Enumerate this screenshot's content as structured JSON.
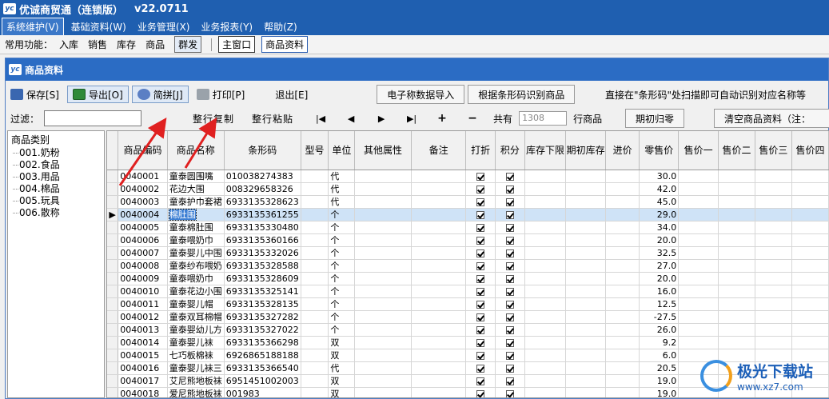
{
  "app": {
    "title": "优诚商贸通（连锁版）",
    "version": "v22.0711"
  },
  "menu": [
    {
      "label": "系统维护(V)",
      "active": true
    },
    {
      "label": "基础资料(W)",
      "active": false
    },
    {
      "label": "业务管理(X)",
      "active": false
    },
    {
      "label": "业务报表(Y)",
      "active": false
    },
    {
      "label": "帮助(Z)",
      "active": false
    }
  ],
  "quick": {
    "label": "常用功能：",
    "items": [
      "入库",
      "销售",
      "库存",
      "商品"
    ],
    "button": "群发",
    "tabs": [
      "主窗口",
      "商品资料"
    ]
  },
  "window": {
    "title": "商品资料"
  },
  "toolbar": {
    "save": "保存[S]",
    "export": "导出[O]",
    "pinyin": "简拼[J]",
    "print": "打印[P]",
    "exit": "退出[E]",
    "scale_import": "电子称数据导入",
    "barcode_identify": "根据条形码识别商品",
    "hint": "直接在\"条形码\"处扫描即可自动识别对应名称等"
  },
  "filter": {
    "label": "过滤：",
    "value": "",
    "copy_row": "整行复制",
    "paste_row": "整行粘贴",
    "nav_first": "|◀",
    "nav_prev": "◀",
    "nav_next": "▶",
    "nav_last": "▶|",
    "add": "+",
    "remove": "−",
    "total_prefix": "共有",
    "total_count": "1308",
    "total_suffix": "行商品",
    "reset_initial": "期初归零",
    "clear_all": "清空商品资料（注："
  },
  "tree": {
    "root": "商品类别",
    "nodes": [
      "001.奶粉",
      "002.食品",
      "003.用品",
      "004.棉品",
      "005.玩具",
      "006.散称"
    ]
  },
  "grid": {
    "columns": [
      "商品编码",
      "商品名称",
      "条形码",
      "型号",
      "单位",
      "其他属性",
      "备注",
      "打折",
      "积分",
      "库存下限",
      "期初库存",
      "进价",
      "零售价",
      "售价一",
      "售价二",
      "售价三",
      "售价四"
    ],
    "current_row_index": 3,
    "rows": [
      {
        "code": "0040001",
        "name": "童泰圆围嘴",
        "barcode": "010038274383",
        "model": "",
        "unit": "代",
        "discount": true,
        "points": true,
        "retail": "30.0"
      },
      {
        "code": "0040002",
        "name": "花边大围",
        "barcode": "008329658326",
        "model": "",
        "unit": "代",
        "discount": true,
        "points": true,
        "retail": "42.0"
      },
      {
        "code": "0040003",
        "name": "童泰护巾套裙",
        "barcode": "6933135328623",
        "model": "",
        "unit": "代",
        "discount": true,
        "points": true,
        "retail": "45.0"
      },
      {
        "code": "0040004",
        "name": "棉肚围",
        "barcode": "6933135361255",
        "model": "",
        "unit": "个",
        "discount": true,
        "points": true,
        "retail": "29.0"
      },
      {
        "code": "0040005",
        "name": "童泰棉肚围",
        "barcode": "6933135330480",
        "model": "",
        "unit": "个",
        "discount": true,
        "points": true,
        "retail": "34.0"
      },
      {
        "code": "0040006",
        "name": "童泰喂奶巾",
        "barcode": "6933135360166",
        "model": "",
        "unit": "个",
        "discount": true,
        "points": true,
        "retail": "20.0"
      },
      {
        "code": "0040007",
        "name": "童泰婴儿中围",
        "barcode": "6933135332026",
        "model": "",
        "unit": "个",
        "discount": true,
        "points": true,
        "retail": "32.5"
      },
      {
        "code": "0040008",
        "name": "童泰纱布喂奶",
        "barcode": "6933135328588",
        "model": "",
        "unit": "个",
        "discount": true,
        "points": true,
        "retail": "27.0"
      },
      {
        "code": "0040009",
        "name": "童泰喂奶巾",
        "barcode": "6933135328609",
        "model": "",
        "unit": "个",
        "discount": true,
        "points": true,
        "retail": "20.0"
      },
      {
        "code": "0040010",
        "name": "童泰花边小围",
        "barcode": "6933135325141",
        "model": "",
        "unit": "个",
        "discount": true,
        "points": true,
        "retail": "16.0"
      },
      {
        "code": "0040011",
        "name": "童泰婴儿帽",
        "barcode": "6933135328135",
        "model": "",
        "unit": "个",
        "discount": true,
        "points": true,
        "retail": "12.5"
      },
      {
        "code": "0040012",
        "name": "童泰双耳棉帽",
        "barcode": "6933135327282",
        "model": "",
        "unit": "个",
        "discount": true,
        "points": true,
        "retail": "-27.5"
      },
      {
        "code": "0040013",
        "name": "童泰婴幼儿方",
        "barcode": "6933135327022",
        "model": "",
        "unit": "个",
        "discount": true,
        "points": true,
        "retail": "26.0"
      },
      {
        "code": "0040014",
        "name": "童泰婴儿袜",
        "barcode": "6933135366298",
        "model": "",
        "unit": "双",
        "discount": true,
        "points": true,
        "retail": "9.2"
      },
      {
        "code": "0040015",
        "name": "七巧板棉袜",
        "barcode": "6926865188188",
        "model": "",
        "unit": "双",
        "discount": true,
        "points": true,
        "retail": "6.0"
      },
      {
        "code": "0040016",
        "name": "童泰婴儿袜三",
        "barcode": "6933135366540",
        "model": "",
        "unit": "代",
        "discount": true,
        "points": true,
        "retail": "20.5"
      },
      {
        "code": "0040017",
        "name": "艾尼熊地板袜",
        "barcode": "6951451002003",
        "model": "",
        "unit": "双",
        "discount": true,
        "points": true,
        "retail": "19.0"
      },
      {
        "code": "0040018",
        "name": "爱尼熊地板袜",
        "barcode": "001983",
        "model": "",
        "unit": "双",
        "discount": true,
        "points": true,
        "retail": "19.0"
      }
    ]
  },
  "watermark": {
    "name": "极光下载站",
    "url": "www.xz7.com"
  },
  "colors": {
    "titlebar": "#1f5fb0",
    "window_title": "#2b6cc4",
    "row_highlight": "#cfe3f7",
    "annotation_arrow": "#e02020"
  }
}
